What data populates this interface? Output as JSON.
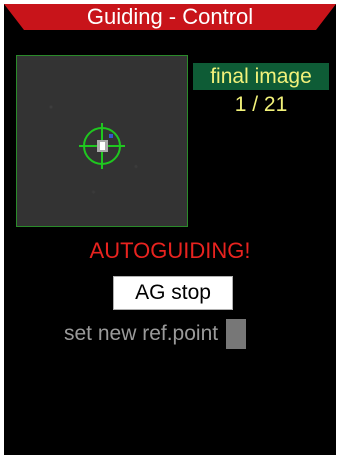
{
  "header": {
    "title": "Guiding - Control"
  },
  "guide_view": {
    "mode_label": "final image",
    "frame_counter": "1 / 21"
  },
  "status": {
    "text": "AUTOGUIDING!"
  },
  "controls": {
    "ag_stop_label": "AG stop",
    "set_ref_point_label": "set new ref.point",
    "set_ref_point_checked": false
  },
  "colors": {
    "background": "#000000",
    "header_red": "#c8141a",
    "mode_badge_bg": "#0e5c36",
    "mode_text": "#f2f27a",
    "status_text": "#e8231f",
    "crosshair": "#1fc71f",
    "disabled_text": "#9a9a9a"
  },
  "icons": {
    "crosshair": "crosshair-icon",
    "guide_star": "star-icon"
  }
}
